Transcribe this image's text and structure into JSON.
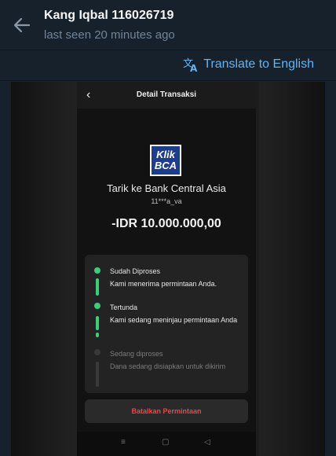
{
  "header": {
    "title": "Kang Iqbal 116026719",
    "status": "last seen 20 minutes ago"
  },
  "translate_bar": {
    "label": "Translate to English"
  },
  "image": {
    "topbar_title": "Detail Transaksi",
    "logo_line1": "Klik",
    "logo_line2": "BCA",
    "bank_name": "Tarik ke Bank Central Asia",
    "account": "11***a_va",
    "amount": "-IDR 10.000.000,00",
    "steps": [
      {
        "title": "Sudah Diproses",
        "desc": "Kami menerima permintaan Anda."
      },
      {
        "title": "Tertunda",
        "desc": "Kami sedang meninjau permintaan Anda"
      },
      {
        "title": "Sedang diproses",
        "desc": "Dana sedang disiapkan untuk dikirim"
      }
    ],
    "cancel_button": "Batalkan Permintaan",
    "nav_icons": [
      "≡",
      "▢",
      "◁"
    ]
  },
  "colors": {
    "accent": "#5eb5f7",
    "step_done": "#33d17a",
    "step_pending": "#3a3a3a",
    "cancel": "#e64a4a"
  }
}
